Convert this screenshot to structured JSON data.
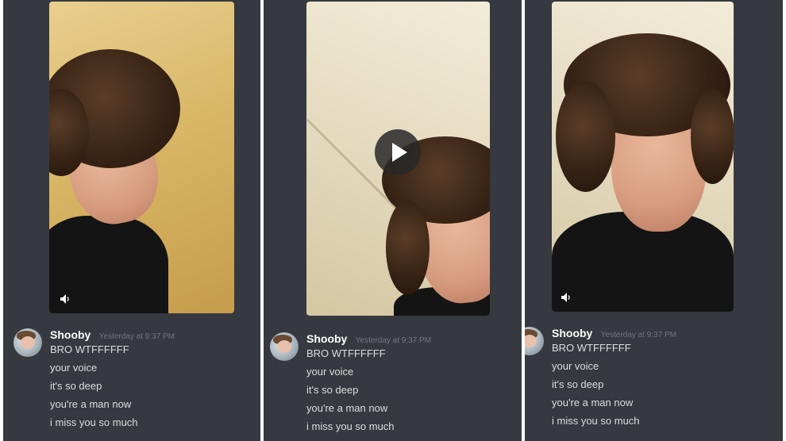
{
  "panels": [
    {
      "username": "Shooby",
      "timestamp": "Yesterday at 9:37 PM",
      "lines": [
        "BRO WTFFFFFF",
        "your voice",
        "it's so deep",
        "you're a man now",
        "i miss you so much"
      ],
      "video_control": "volume-icon"
    },
    {
      "username": "Shooby",
      "timestamp": "Yesterday at 9:37 PM",
      "lines": [
        "BRO WTFFFFFF",
        "your voice",
        "it's so deep",
        "you're a man now",
        "i miss you so much"
      ],
      "video_control": "play-icon"
    },
    {
      "username": "Shooby",
      "timestamp": "Yesterday at 9:37 PM",
      "lines": [
        "BRO WTFFFFFF",
        "your voice",
        "it's so deep",
        "you're a man now",
        "i miss you so much"
      ],
      "video_control": "volume-icon"
    }
  ],
  "colors": {
    "background": "#36393f",
    "username": "#ffffff",
    "message_text": "#dcddde",
    "timestamp": "#72767d"
  }
}
